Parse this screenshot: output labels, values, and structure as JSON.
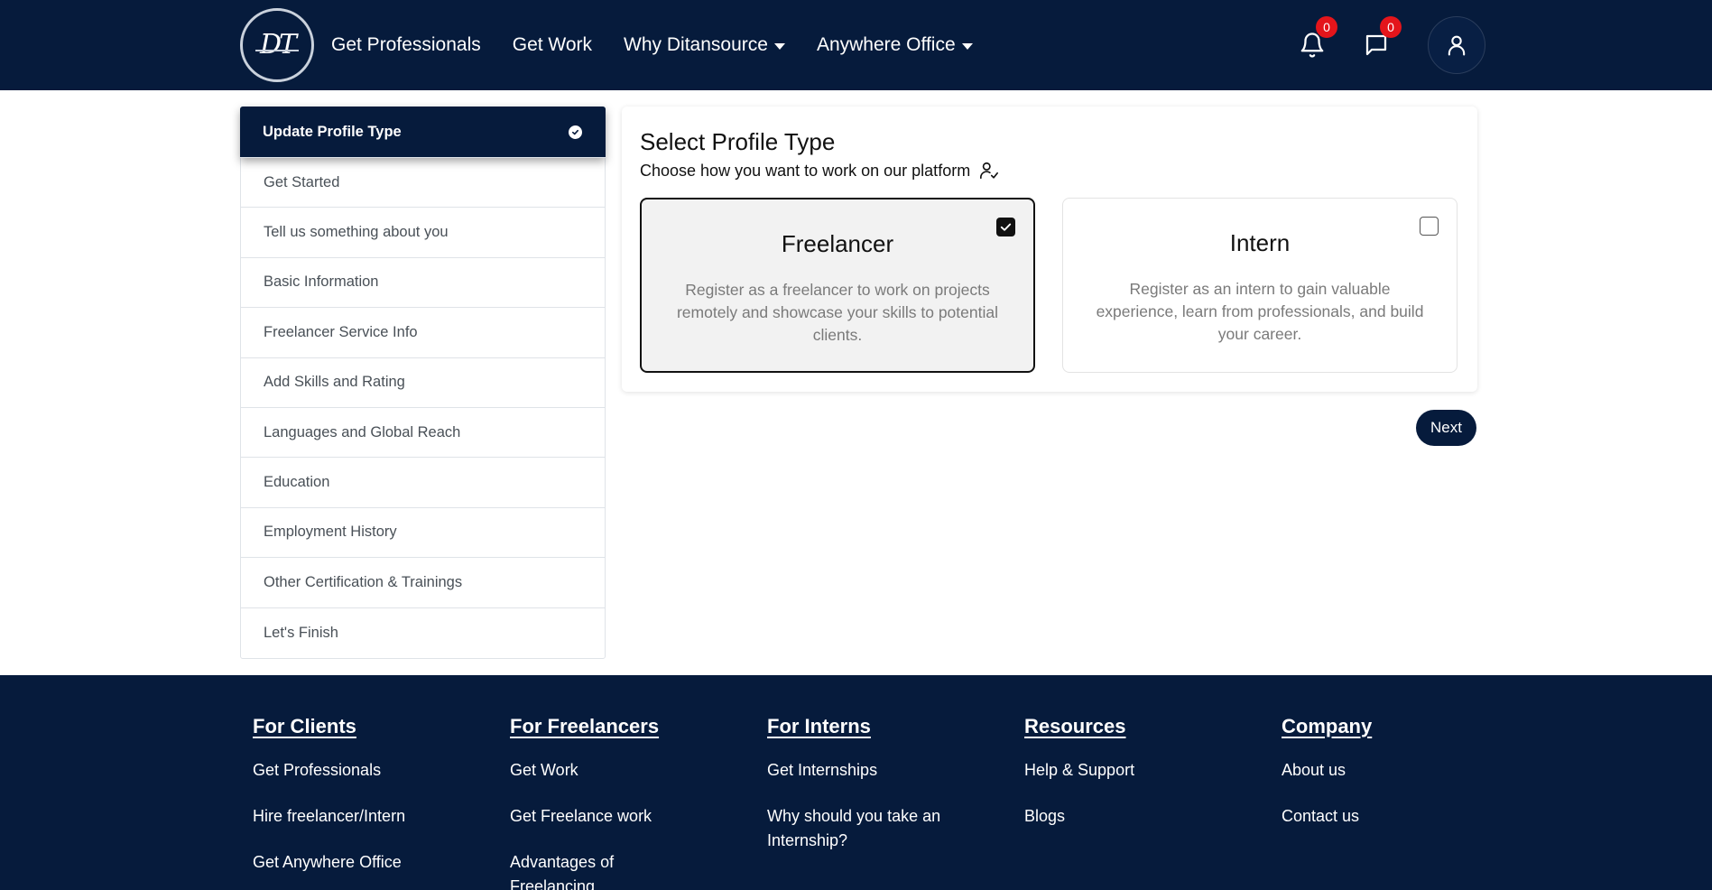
{
  "nav": {
    "logo_text": "DT",
    "links": [
      {
        "label": "Get Professionals"
      },
      {
        "label": "Get Work"
      },
      {
        "label": "Why Ditansource"
      },
      {
        "label": "Anywhere Office"
      }
    ],
    "notifications_count": "0",
    "messages_count": "0"
  },
  "sidebar": {
    "steps": [
      {
        "label": "Update Profile Type"
      },
      {
        "label": "Get Started"
      },
      {
        "label": "Tell us something about you"
      },
      {
        "label": "Basic Information"
      },
      {
        "label": "Freelancer Service Info"
      },
      {
        "label": "Add Skills and Rating"
      },
      {
        "label": "Languages and Global Reach"
      },
      {
        "label": "Education"
      },
      {
        "label": "Employment History"
      },
      {
        "label": "Other Certification & Trainings"
      },
      {
        "label": "Let's Finish"
      }
    ]
  },
  "main": {
    "title": "Select Profile Type",
    "subtitle": "Choose how you want to work on our platform",
    "options": [
      {
        "name": "Freelancer",
        "description": "Register as a freelancer to work on projects remotely and showcase your skills to potential clients.",
        "selected": true
      },
      {
        "name": "Intern",
        "description": "Register as an intern to gain valuable experience, learn from professionals, and build your career.",
        "selected": false
      }
    ],
    "next_label": "Next"
  },
  "footer": {
    "columns": [
      {
        "heading": "For Clients",
        "links": [
          "Get Professionals",
          "Hire freelancer/Intern",
          "Get Anywhere Office"
        ]
      },
      {
        "heading": "For Freelancers",
        "links": [
          "Get Work",
          "Get Freelance work",
          "Advantages of Freelancing"
        ]
      },
      {
        "heading": "For Interns",
        "links": [
          "Get Internships",
          "Why should you take an Internship?"
        ]
      },
      {
        "heading": "Resources",
        "links": [
          "Help & Support",
          "Blogs"
        ]
      },
      {
        "heading": "Company",
        "links": [
          "About us",
          "Contact us"
        ]
      }
    ]
  },
  "colors": {
    "navy": "#061b3c",
    "badge_red": "#e4151b",
    "card_selected_bg": "#f2f2f2"
  },
  "icons": [
    "bell-icon",
    "chat-icon",
    "user-icon",
    "user-check-icon",
    "check-circle-icon",
    "caret-down-icon"
  ]
}
